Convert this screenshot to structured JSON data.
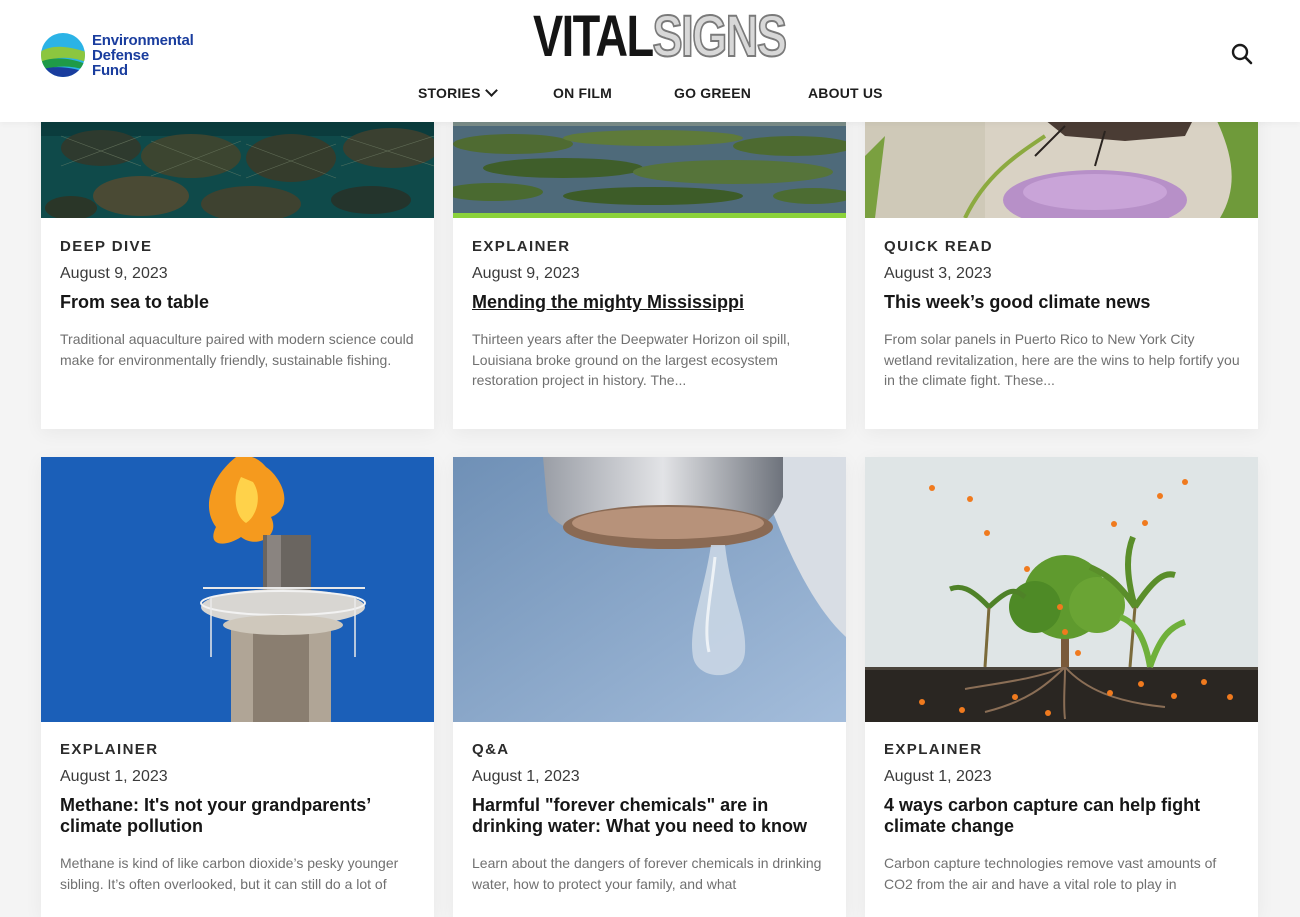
{
  "brand": {
    "org_line1": "Environmental",
    "org_line2": "Defense",
    "org_line3": "Fund",
    "masthead_dark": "VITAL",
    "masthead_light": "SIGNS"
  },
  "nav": {
    "stories": "STORIES",
    "on_film": "ON FILM",
    "go_green": "GO GREEN",
    "about_us": "ABOUT US"
  },
  "cards": [
    {
      "kicker": "DEEP DIVE",
      "date": "August 9, 2023",
      "title": "From sea to table",
      "excerpt": "Traditional aquaculture paired with modern science could make for environmentally friendly, sustainable fishing."
    },
    {
      "kicker": "EXPLAINER",
      "date": "August 9, 2023",
      "title": "Mending the mighty Mississippi",
      "excerpt": "Thirteen years after the Deepwater Horizon oil spill, Louisiana broke ground on the largest ecosystem restoration project in history. The..."
    },
    {
      "kicker": "QUICK READ",
      "date": "August 3, 2023",
      "title": "This week’s good climate news",
      "excerpt": "From solar panels in Puerto Rico to New York City wetland revitalization, here are the wins to help fortify you in the climate fight. These..."
    },
    {
      "kicker": "EXPLAINER",
      "date": "August 1, 2023",
      "title": "Methane: It's not your grandparents’ climate pollution",
      "excerpt": "Methane is kind of like carbon dioxide’s pesky younger sibling. It’s often overlooked, but it can still do a lot of"
    },
    {
      "kicker": "Q&A",
      "date": "August 1, 2023",
      "title": "Harmful \"forever chemicals\" are in drinking water: What you need to know",
      "excerpt": "Learn about the dangers of forever chemicals in drinking water, how to protect your family, and what"
    },
    {
      "kicker": "EXPLAINER",
      "date": "August 1, 2023",
      "title": "4 ways carbon capture can help fight climate change",
      "excerpt": "Carbon capture technologies remove vast amounts of CO2 from the air and have a vital role to play in"
    }
  ],
  "colors": {
    "brand_blue": "#1a3d9e",
    "accent_green": "#8bd23a",
    "page_bg": "#f4f4f4"
  },
  "icons": {
    "search": "search-icon",
    "chevron": "chevron-down-icon"
  }
}
